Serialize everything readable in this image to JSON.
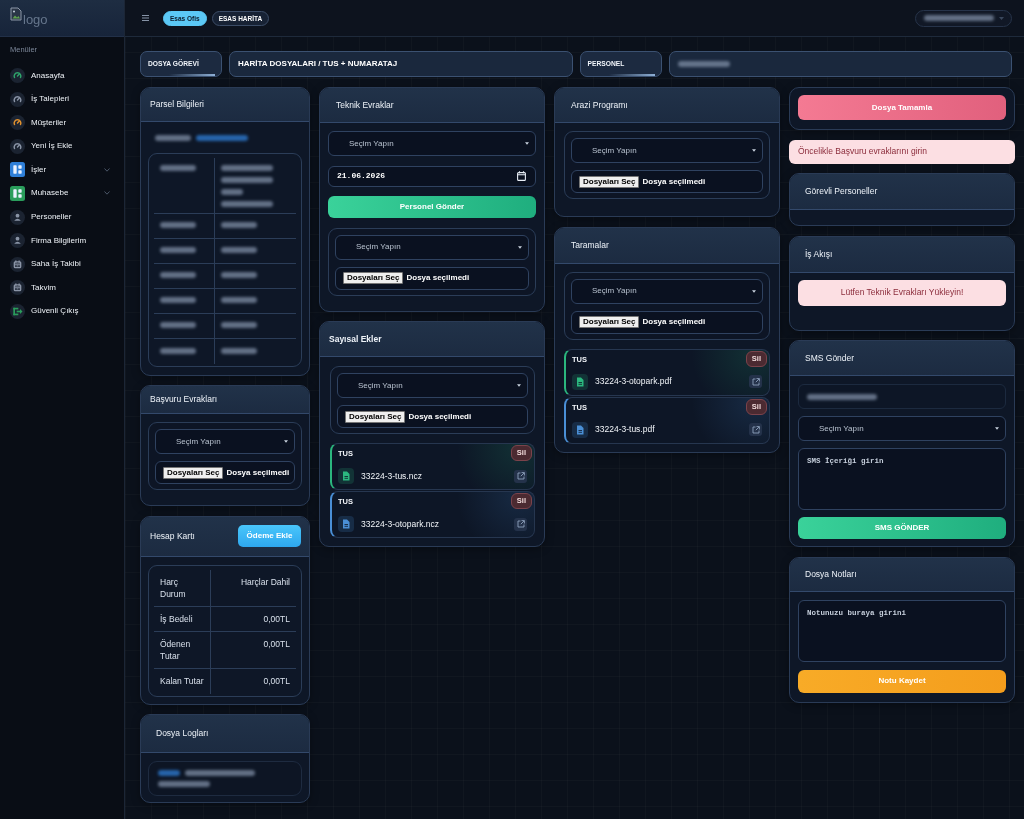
{
  "sidebar": {
    "logo_alt": "logo",
    "section_title": "Menüler",
    "items": [
      {
        "label": "Anasayfa",
        "kind": "gauge",
        "color": "#2fa36b",
        "submenu": false
      },
      {
        "label": "İş Talepleri",
        "kind": "gauge",
        "color": "#8a94a6",
        "submenu": false
      },
      {
        "label": "Müşteriler",
        "kind": "gauge",
        "color": "#e0912f",
        "submenu": false
      },
      {
        "label": "Yeni İş Ekle",
        "kind": "gauge",
        "color": "#8a94a6",
        "submenu": false
      },
      {
        "label": "İşler",
        "kind": "blocks",
        "color": "#2f7fd8",
        "submenu": true
      },
      {
        "label": "Muhasebe",
        "kind": "blocks",
        "color": "#2a9d5c",
        "submenu": true
      },
      {
        "label": "Personeller",
        "kind": "person",
        "color": "#8a94a6",
        "submenu": false
      },
      {
        "label": "Firma Bilgilerim",
        "kind": "person",
        "color": "#8a94a6",
        "submenu": false
      },
      {
        "label": "Saha İş Takibi",
        "kind": "calendar",
        "color": "#8a94a6",
        "submenu": false
      },
      {
        "label": "Takvim",
        "kind": "calendar",
        "color": "#8a94a6",
        "submenu": false
      },
      {
        "label": "Güvenli Çıkış",
        "kind": "exit",
        "color": "#2a9d5c",
        "submenu": false
      }
    ]
  },
  "topbar": {
    "toggles": [
      {
        "label": "Esas Ofis",
        "selected": true
      },
      {
        "label": "ESAS HARİTA",
        "selected": false
      }
    ],
    "user_menu": {
      "blurred": true
    }
  },
  "info_bar": [
    {
      "kind": "label",
      "text": "DOSYA GÖREVİ"
    },
    {
      "kind": "value",
      "text": "HARİTA DOSYALARI / TUS + NUMARATAJ"
    },
    {
      "kind": "label",
      "text": "PERSONEL"
    },
    {
      "kind": "value",
      "blurred": true
    }
  ],
  "parcel_info": {
    "title": "Parsel Bilgileri",
    "owner_line": {
      "blurred": true
    },
    "rows": [
      {
        "kind": "multiline",
        "blurred": true
      },
      {
        "kind": "line",
        "blurred": true
      },
      {
        "kind": "line",
        "blurred": true
      },
      {
        "kind": "line",
        "blurred": true
      },
      {
        "kind": "line",
        "blurred": true
      },
      {
        "kind": "line",
        "blurred": true
      },
      {
        "kind": "line",
        "blurred": true
      }
    ]
  },
  "application_docs": {
    "title": "Başvuru Evrakları",
    "upload": {
      "select": "Seçim Yapın",
      "file_button": "Dosyaları Seç",
      "file_status": "Dosya seçilmedi"
    }
  },
  "account_card": {
    "title": "Hesap Kartı",
    "add_button": "Ödeme Ekle",
    "rows": [
      {
        "label": "Harç Durum",
        "value": "Harçlar Dahil"
      },
      {
        "label": "İş Bedeli",
        "value": "0,00TL"
      },
      {
        "label": "Ödenen Tutar",
        "value": "0,00TL"
      },
      {
        "label": "Kalan Tutar",
        "value": "0,00TL"
      }
    ]
  },
  "file_logs": {
    "title": "Dosya Logları",
    "entries": [
      {
        "blurred": true
      }
    ]
  },
  "technical_docs": {
    "title": "Teknik Evraklar",
    "select": "Seçim Yapın",
    "date": "21.06.2026",
    "send_button": "Personel Gönder",
    "upload": {
      "select": "Seçim Yapın",
      "file_button": "Dosyaları Seç",
      "file_status": "Dosya seçilmedi"
    }
  },
  "digital_attachments": {
    "title": "Sayısal Ekler",
    "upload": {
      "select": "Seçim Yapın",
      "file_button": "Dosyaları Seç",
      "file_status": "Dosya seçilmedi"
    },
    "files": [
      {
        "tag": "TUS",
        "delete": "Sil",
        "name": "33224-3-tus.ncz",
        "color": "#2bb77e"
      },
      {
        "tag": "TUS",
        "delete": "Sil",
        "name": "33224-3-otopark.ncz",
        "color": "#4a8fd6"
      }
    ]
  },
  "field_program": {
    "title": "Arazi Programı",
    "upload": {
      "select": "Seçim Yapın",
      "file_button": "Dosyaları Seç",
      "file_status": "Dosya seçilmedi"
    }
  },
  "scans": {
    "title": "Taramalar",
    "upload": {
      "select": "Seçim Yapın",
      "file_button": "Dosyaları Seç",
      "file_status": "Dosya seçilmedi"
    },
    "files": [
      {
        "tag": "TUS",
        "delete": "Sil",
        "name": "33224-3-otopark.pdf",
        "color": "#2bb77e"
      },
      {
        "tag": "TUS",
        "delete": "Sil",
        "name": "33224-3-tus.pdf",
        "color": "#4a8fd6"
      }
    ]
  },
  "complete_button": "Dosya Tamamla",
  "notice": "Öncelikle Başvuru evraklarını girin",
  "assigned_staff": {
    "title": "Görevli Personeller"
  },
  "workflow": {
    "title": "İş Akışı",
    "alert": "Lütfen Teknik Evrakları Yükleyin!"
  },
  "sms": {
    "title": "SMS Gönder",
    "phone": {
      "blurred": true
    },
    "select": "Seçim Yapın",
    "message": {
      "placeholder": "SMS İçeriği girin"
    },
    "send_button": "SMS GÖNDER"
  },
  "notes": {
    "title": "Dosya Notları",
    "note": {
      "placeholder": "Notunuzu buraya girini"
    },
    "save_button": "Notu Kaydet"
  }
}
